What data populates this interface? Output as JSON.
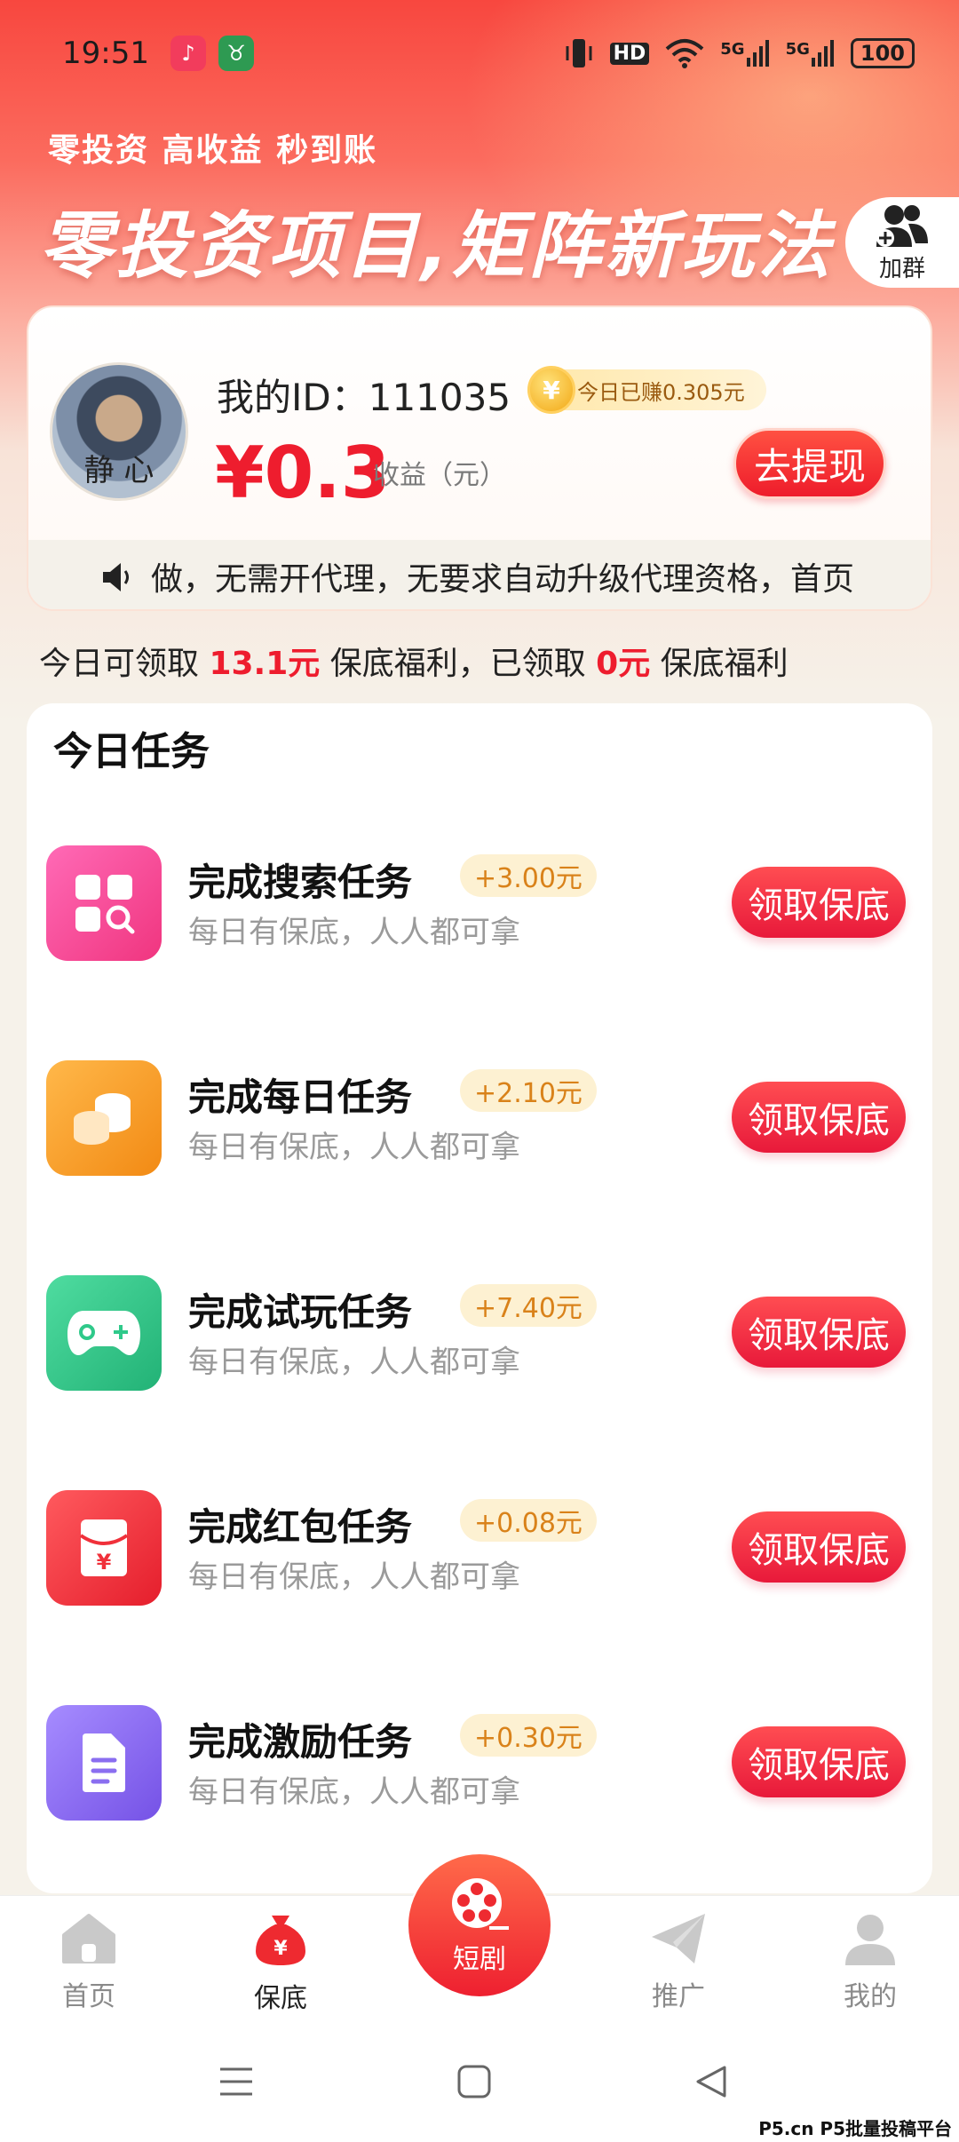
{
  "status_bar": {
    "time": "19:51",
    "network_hd": "HD",
    "network_5g_1": "5G",
    "network_5g_2": "5G",
    "battery": "100"
  },
  "header": {
    "slogan": "零投资 高收益 秒到账",
    "headline": "零投资项目,矩阵新玩法",
    "join_group_label": "加群"
  },
  "profile": {
    "avatar_char": "静 心",
    "id_text": "我的ID：111035",
    "today_earned": "今日已赚0.305元",
    "coin_symbol": "¥",
    "balance": "¥0.3",
    "balance_label": "收益（元）",
    "withdraw_label": "去提现",
    "marquee": "做，无需开代理，无要求自动升级代理资格，首页"
  },
  "welfare": {
    "prefix": "今日可领取 ",
    "amount_available": "13.1元",
    "middle": " 保底福利，已领取 ",
    "amount_claimed": "0元",
    "suffix": " 保底福利"
  },
  "tasks": {
    "title": "今日任务",
    "items": [
      {
        "name": "完成搜索任务",
        "reward": "+3.00元",
        "desc": "每日有保底，人人都可拿",
        "button": "领取保底",
        "icon": "search-grid-icon",
        "color": "#f7469a"
      },
      {
        "name": "完成每日任务",
        "reward": "+2.10元",
        "desc": "每日有保底，人人都可拿",
        "button": "领取保底",
        "icon": "coins-icon",
        "color": "#f7a026"
      },
      {
        "name": "完成试玩任务",
        "reward": "+7.40元",
        "desc": "每日有保底，人人都可拿",
        "button": "领取保底",
        "icon": "gamepad-icon",
        "color": "#2fc98a"
      },
      {
        "name": "完成红包任务",
        "reward": "+0.08元",
        "desc": "每日有保底，人人都可拿",
        "button": "领取保底",
        "icon": "red-envelope-icon",
        "color": "#f0303a"
      },
      {
        "name": "完成激励任务",
        "reward": "+0.30元",
        "desc": "每日有保底，人人都可拿",
        "button": "领取保底",
        "icon": "document-icon",
        "color": "#8a6ef0"
      }
    ]
  },
  "bottom_nav": {
    "items": [
      {
        "label": "首页",
        "icon": "home-icon"
      },
      {
        "label": "保底",
        "icon": "money-bag-icon"
      },
      {
        "label": "短剧",
        "icon": "film-reel-icon"
      },
      {
        "label": "推广",
        "icon": "paper-plane-icon"
      },
      {
        "label": "我的",
        "icon": "user-icon"
      }
    ],
    "active": "保底"
  },
  "watermark": "P5.cn P5批量投稿平台"
}
